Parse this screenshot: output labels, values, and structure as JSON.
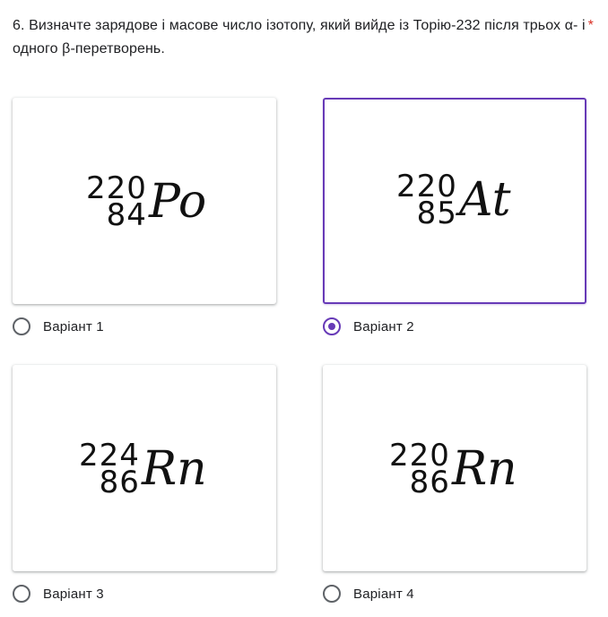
{
  "question": {
    "text": "6.  Визначте зарядове і масове число ізотопу, який вийде із Торію-232   після трьох α- і одного β-перетворень.",
    "required_mark": "*",
    "required_color": "#d93025"
  },
  "accent_color": "#673ab7",
  "options": [
    {
      "label": "Варіант 1",
      "mass": "220",
      "charge": "84",
      "symbol": "Po",
      "selected": false
    },
    {
      "label": "Варіант 2",
      "mass": "220",
      "charge": "85",
      "symbol": "At",
      "selected": true
    },
    {
      "label": "Варіант 3",
      "mass": "224",
      "charge": "86",
      "symbol": "Rn",
      "selected": false
    },
    {
      "label": "Варіант 4",
      "mass": "220",
      "charge": "86",
      "symbol": "Rn",
      "selected": false
    }
  ]
}
